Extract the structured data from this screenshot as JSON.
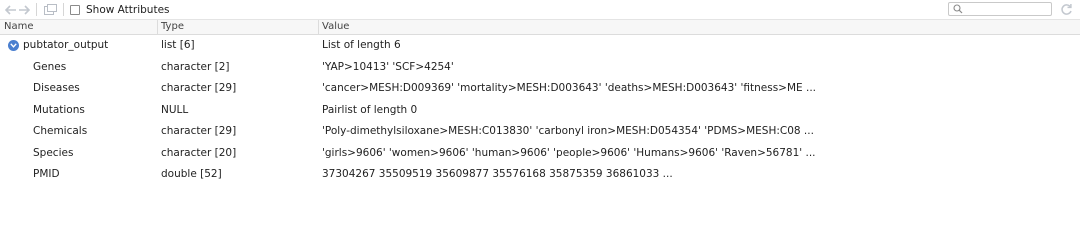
{
  "toolbar": {
    "show_attributes_label": "Show Attributes",
    "search_placeholder": ""
  },
  "columns": {
    "name": "Name",
    "type": "Type",
    "value": "Value"
  },
  "root": {
    "name": "pubtator_output",
    "type": "list [6]",
    "value": "List of length 6"
  },
  "items": [
    {
      "name": "Genes",
      "type": "character [2]",
      "value": "'YAP>10413' 'SCF>4254'"
    },
    {
      "name": "Diseases",
      "type": "character [29]",
      "value": "'cancer>MESH:D009369' 'mortality>MESH:D003643' 'deaths>MESH:D003643' 'fitness>ME ..."
    },
    {
      "name": "Mutations",
      "type": "NULL",
      "value": "Pairlist of length 0"
    },
    {
      "name": "Chemicals",
      "type": "character [29]",
      "value": "'Poly-dimethylsiloxane>MESH:C013830' 'carbonyl iron>MESH:D054354' 'PDMS>MESH:C08 ..."
    },
    {
      "name": "Species",
      "type": "character [20]",
      "value": "'girls>9606' 'women>9606' 'human>9606' 'people>9606' 'Humans>9606' 'Raven>56781' ..."
    },
    {
      "name": "PMID",
      "type": "double [52]",
      "value": "37304267 35509519 35609877 35576168 35875359 36861033 ..."
    }
  ],
  "colors": {
    "expand_icon": "#4a7fcf",
    "header_bg": "#f7f7f7"
  }
}
